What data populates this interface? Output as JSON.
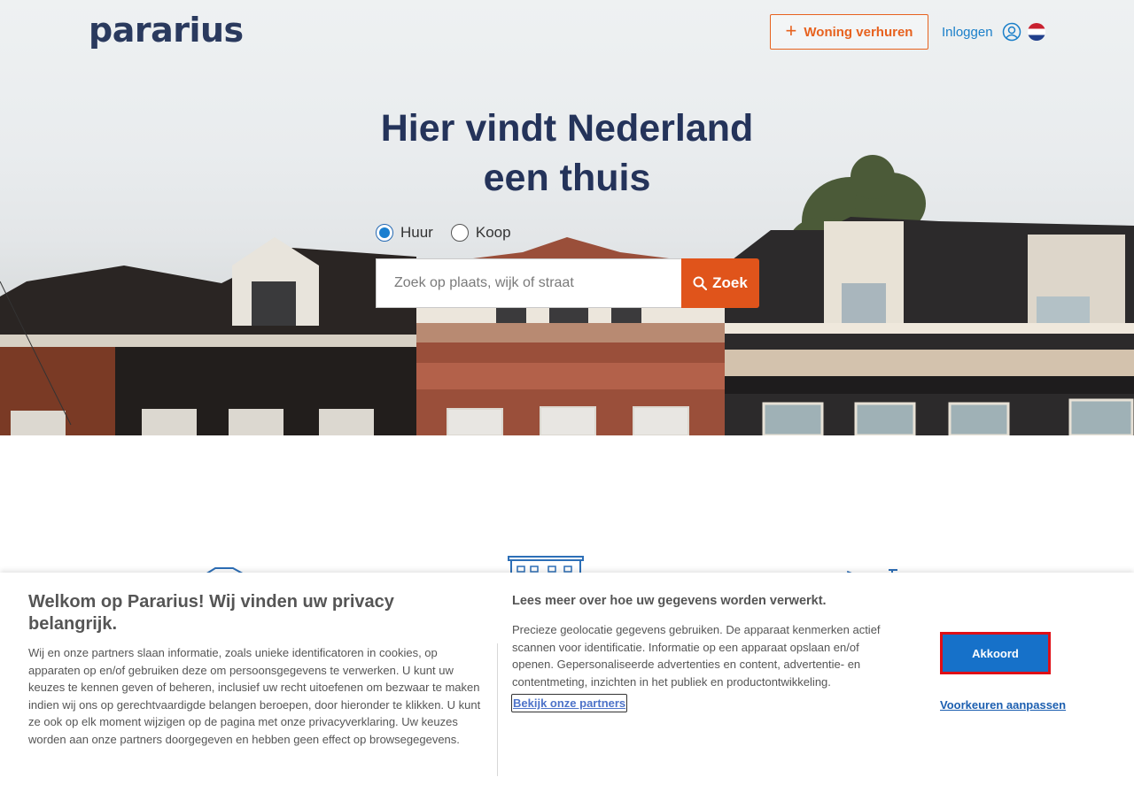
{
  "header": {
    "logo_text": "pararius",
    "rent_button_label": "Woning verhuren",
    "login_label": "Inloggen",
    "language_flag": "NL"
  },
  "hero": {
    "headline_line1": "Hier vindt Nederland",
    "headline_line2": "een thuis",
    "radio_options": [
      {
        "label": "Huur",
        "selected": true
      },
      {
        "label": "Koop",
        "selected": false
      }
    ],
    "search_placeholder": "Zoek op plaats, wijk of straat",
    "search_button_label": "Zoek"
  },
  "consent": {
    "title": "Welkom op Pararius! Wij vinden uw privacy belangrijk.",
    "body": "Wij en onze partners slaan informatie, zoals unieke identificatoren in cookies, op apparaten op en/of gebruiken deze om persoonsgegevens te verwerken. U kunt uw keuzes te kennen geven of beheren, inclusief uw recht uitoefenen om bezwaar te maken indien wij ons op gerechtvaardigde belangen beroepen, door hieronder te klikken. U kunt ze ook op elk moment wijzigen op de pagina met onze privacyverklaring. Uw keuzes worden aan onze partners doorgegeven en hebben geen effect op browsegegevens.",
    "subtitle": "Lees meer over hoe uw gegevens worden verwerkt.",
    "purposes": "Precieze geolocatie gegevens gebruiken. De apparaat kenmerken actief scannen voor identificatie. Informatie op een apparaat opslaan en/of openen. Gepersonaliseerde advertenties en content, advertentie- en contentmeting, inzichten in het publiek en productontwikkeling.",
    "partners_link": "Bekijk onze partners",
    "accept_button": "Akkoord",
    "preferences_link": "Voorkeuren aanpassen"
  },
  "colors": {
    "brand_navy": "#24335a",
    "accent_orange": "#e0541b",
    "link_blue": "#1a7fc9",
    "accept_blue": "#1671c9"
  }
}
